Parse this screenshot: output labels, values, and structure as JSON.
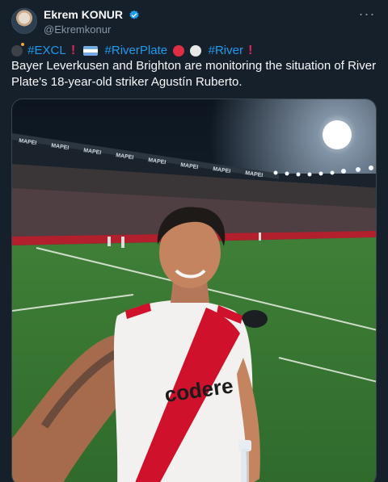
{
  "author": {
    "display_name": "Ekrem KONUR",
    "handle": "@Ekremkonur",
    "verified": true,
    "verified_color": "#1d9bf0"
  },
  "tweet": {
    "hashtags": [
      "#EXCL",
      "#RiverPlate",
      "#River"
    ],
    "text": "Bayer Leverkusen and Brighton are monitoring the situation of River Plate's 18-year-old striker Agustín Ruberto.",
    "more_label": "···"
  },
  "media": {
    "stadium_banner": [
      "MAPEI",
      "MAPEI",
      "MAPEI",
      "MAPEI",
      "MAPEI",
      "MAPEI",
      "MAPEI",
      "MAPEI"
    ],
    "shirt_sponsor": "codere"
  },
  "colors": {
    "background": "#15202b",
    "link": "#1d9bf0",
    "muted": "#8b98a5",
    "pitch": "#3d7a36",
    "shirt_stripe": "#d0112b"
  }
}
